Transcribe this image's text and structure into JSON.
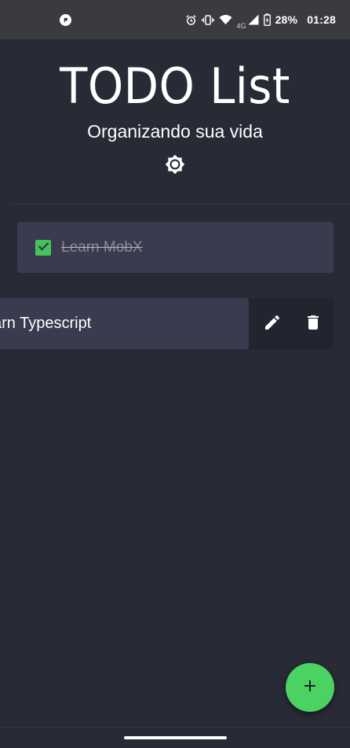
{
  "status_bar": {
    "network_type": "4G",
    "battery_percent": "28%",
    "time": "01:28",
    "icons": [
      "app-notification-icon",
      "alarm-icon",
      "vibrate-icon",
      "wifi-icon",
      "cellular-signal-icon",
      "battery-charging-icon"
    ]
  },
  "header": {
    "title": "TODO List",
    "subtitle": "Organizando sua vida",
    "theme_toggle_icon": "brightness-icon"
  },
  "todos": [
    {
      "text": "Learn MobX",
      "completed": true
    },
    {
      "text": "Learn Typescript",
      "visible_text": "arn Typescript",
      "completed": false,
      "swiped_open": true
    }
  ],
  "swipe_actions": {
    "edit_icon": "pencil-icon",
    "delete_icon": "trash-icon"
  },
  "fab": {
    "icon": "plus-icon"
  },
  "colors": {
    "background": "#282a36",
    "card": "#3a3b4f",
    "accent_green": "#4cd263",
    "status_bar": "#3a3b3f"
  }
}
